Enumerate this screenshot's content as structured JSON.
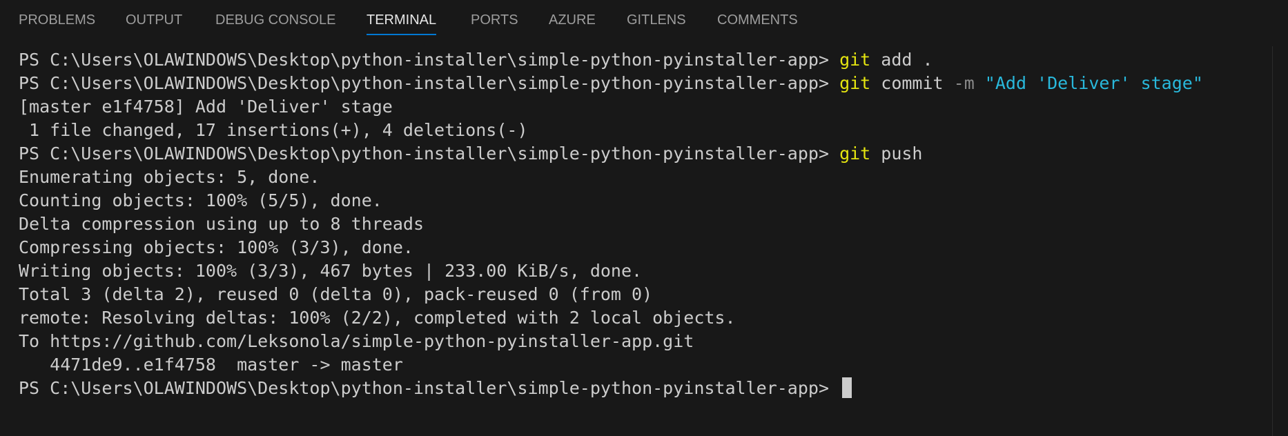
{
  "tabs": [
    {
      "label": "PROBLEMS"
    },
    {
      "label": "OUTPUT"
    },
    {
      "label": "DEBUG CONSOLE"
    },
    {
      "label": "TERMINAL"
    },
    {
      "label": "PORTS"
    },
    {
      "label": "AZURE"
    },
    {
      "label": "GITLENS"
    },
    {
      "label": "COMMENTS"
    }
  ],
  "active_tab": "TERMINAL",
  "terminal": {
    "prompt": "PS C:\\Users\\OLAWINDOWS\\Desktop\\python-installer\\simple-python-pyinstaller-app> ",
    "cmd1": {
      "git": "git",
      "rest": " add ."
    },
    "cmd2": {
      "git": "git",
      "rest": " commit ",
      "flag": "-m",
      "message": " \"Add 'Deliver' stage\""
    },
    "commit_result": "[master e1f4758] Add 'Deliver' stage",
    "commit_stats": " 1 file changed, 17 insertions(+), 4 deletions(-)",
    "cmd3": {
      "git": "git",
      "rest": " push"
    },
    "push_output": [
      "Enumerating objects: 5, done.",
      "Counting objects: 100% (5/5), done.",
      "Delta compression using up to 8 threads",
      "Compressing objects: 100% (3/3), done.",
      "Writing objects: 100% (3/3), 467 bytes | 233.00 KiB/s, done.",
      "Total 3 (delta 2), reused 0 (delta 0), pack-reused 0 (from 0)",
      "remote: Resolving deltas: 100% (2/2), completed with 2 local objects.",
      "To https://github.com/Leksonola/simple-python-pyinstaller-app.git",
      "   4471de9..e1f4758  master -> master"
    ]
  },
  "colors": {
    "background": "#181818",
    "text": "#cccccc",
    "command": "#e5e510",
    "flag": "#8a8a8a",
    "string": "#29b8db",
    "active_tab_underline": "#0078d4"
  }
}
